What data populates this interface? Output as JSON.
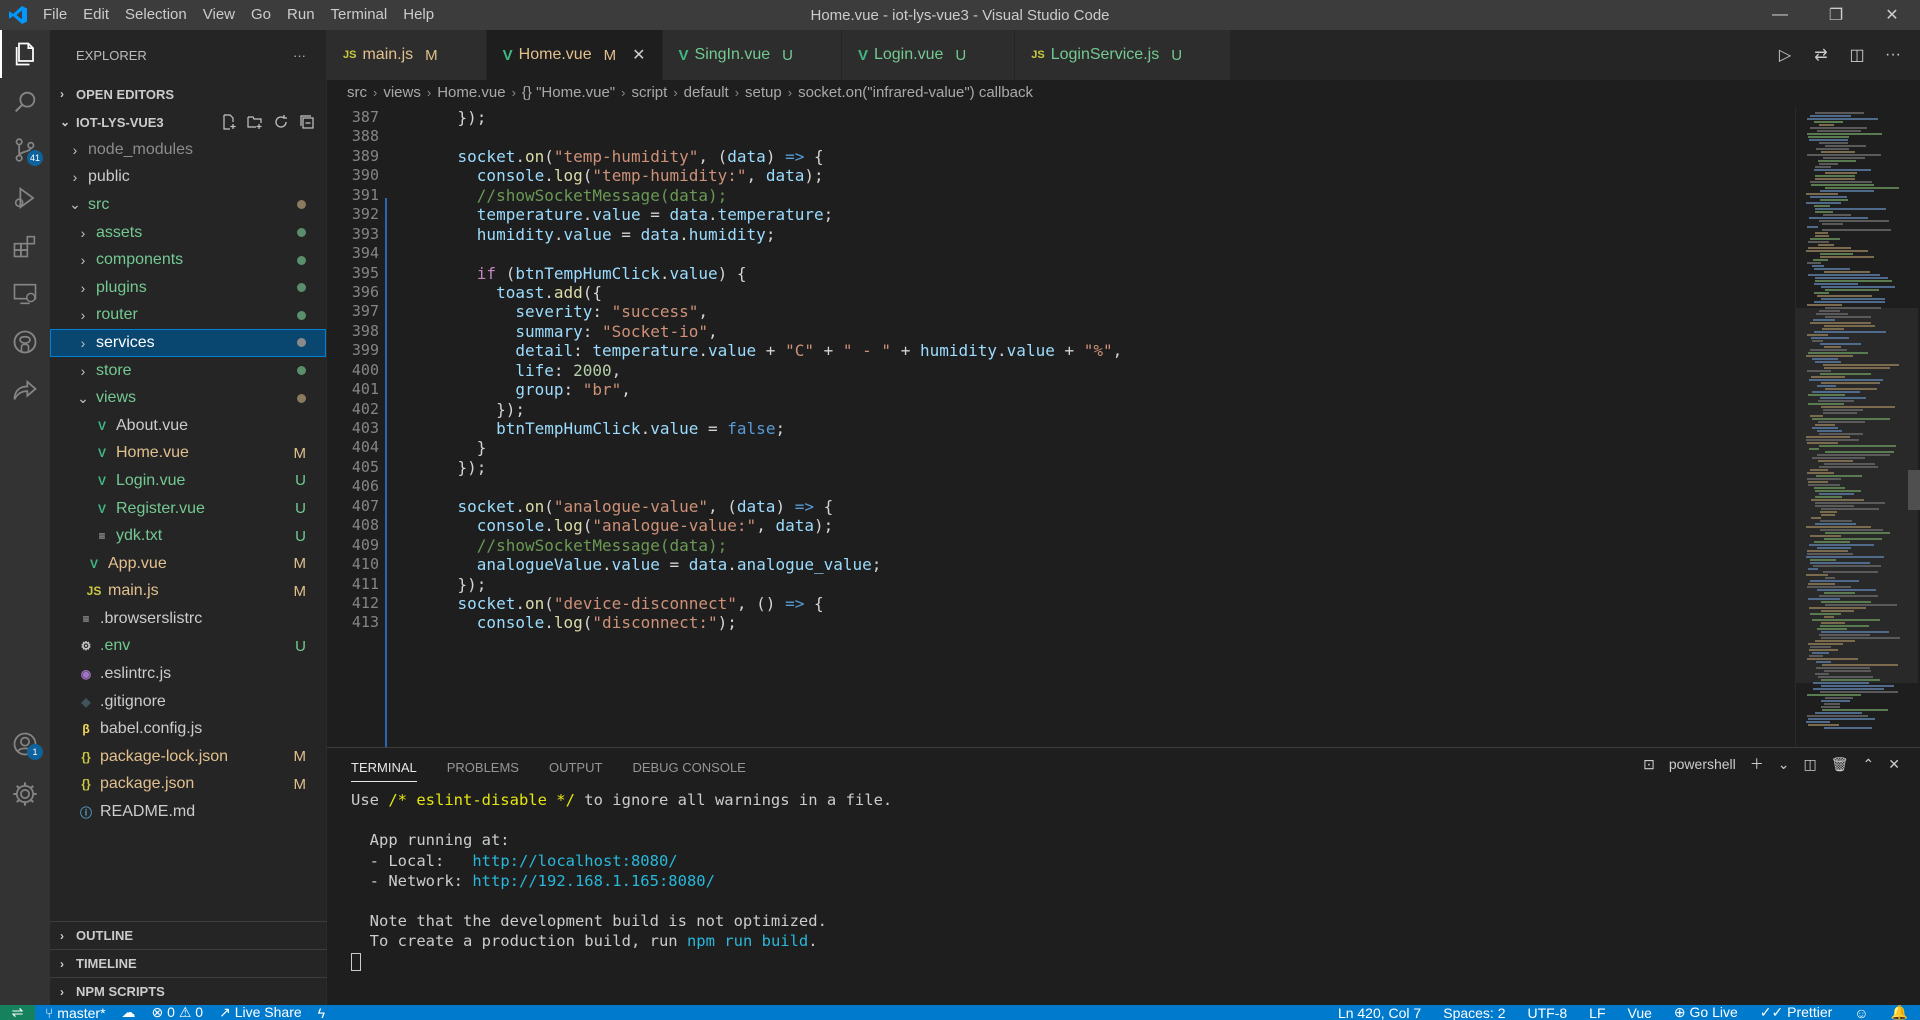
{
  "window": {
    "title": "Home.vue - iot-lys-vue3 - Visual Studio Code",
    "menu": [
      "File",
      "Edit",
      "Selection",
      "View",
      "Go",
      "Run",
      "Terminal",
      "Help"
    ],
    "controls": [
      "—",
      "❐",
      "✕"
    ]
  },
  "activity_bar": {
    "scm_badge": "41",
    "accounts_badge": "1",
    "items": [
      "explorer-icon",
      "search-icon",
      "source-control-icon",
      "run-debug-icon",
      "extensions-icon",
      "remote-explorer-icon",
      "github-icon",
      "live-share-icon",
      "accounts-icon",
      "settings-gear-icon"
    ]
  },
  "sidebar": {
    "header": "EXPLORER",
    "open_editors": "OPEN EDITORS",
    "project": "IOT-LYS-VUE3",
    "tree": [
      {
        "label": "node_modules",
        "type": "folder",
        "indent": 1,
        "color": "dim",
        "status": ""
      },
      {
        "label": "public",
        "type": "folder",
        "indent": 1,
        "color": "normal",
        "status": ""
      },
      {
        "label": "src",
        "type": "folder-open",
        "indent": 1,
        "color": "green",
        "status": "dot"
      },
      {
        "label": "assets",
        "type": "folder",
        "indent": 2,
        "color": "green",
        "status": "dot"
      },
      {
        "label": "components",
        "type": "folder",
        "indent": 2,
        "color": "green",
        "status": "dot"
      },
      {
        "label": "plugins",
        "type": "folder",
        "indent": 2,
        "color": "green",
        "status": "dot"
      },
      {
        "label": "router",
        "type": "folder",
        "indent": 2,
        "color": "green",
        "status": "dot"
      },
      {
        "label": "services",
        "type": "folder",
        "indent": 2,
        "color": "selected",
        "status": "dot"
      },
      {
        "label": "store",
        "type": "folder",
        "indent": 2,
        "color": "green",
        "status": "dot"
      },
      {
        "label": "views",
        "type": "folder-open",
        "indent": 2,
        "color": "green",
        "status": "dot"
      },
      {
        "label": "About.vue",
        "type": "vue",
        "indent": 3,
        "color": "normal",
        "status": ""
      },
      {
        "label": "Home.vue",
        "type": "vue",
        "indent": 3,
        "color": "mod",
        "status": "M"
      },
      {
        "label": "Login.vue",
        "type": "vue",
        "indent": 3,
        "color": "green",
        "status": "U"
      },
      {
        "label": "Register.vue",
        "type": "vue",
        "indent": 3,
        "color": "green",
        "status": "U"
      },
      {
        "label": "ydk.txt",
        "type": "txt",
        "indent": 3,
        "color": "green",
        "status": "U"
      },
      {
        "label": "App.vue",
        "type": "vue",
        "indent": 2,
        "color": "mod",
        "status": "M"
      },
      {
        "label": "main.js",
        "type": "js",
        "indent": 2,
        "color": "mod",
        "status": "M"
      },
      {
        "label": ".browserslistrc",
        "type": "list",
        "indent": 1,
        "color": "normal",
        "status": ""
      },
      {
        "label": ".env",
        "type": "gear",
        "indent": 1,
        "color": "green",
        "status": "U"
      },
      {
        "label": ".eslintrc.js",
        "type": "eslint",
        "indent": 1,
        "color": "normal",
        "status": ""
      },
      {
        "label": ".gitignore",
        "type": "git",
        "indent": 1,
        "color": "normal",
        "status": ""
      },
      {
        "label": "babel.config.js",
        "type": "babel",
        "indent": 1,
        "color": "normal",
        "status": ""
      },
      {
        "label": "package-lock.json",
        "type": "json",
        "indent": 1,
        "color": "mod",
        "status": "M"
      },
      {
        "label": "package.json",
        "type": "json",
        "indent": 1,
        "color": "mod",
        "status": "M"
      },
      {
        "label": "README.md",
        "type": "info",
        "indent": 1,
        "color": "normal",
        "status": ""
      }
    ],
    "bottom_sections": [
      "OUTLINE",
      "TIMELINE",
      "NPM SCRIPTS"
    ]
  },
  "tabs": [
    {
      "icon": "JS",
      "label": "main.js",
      "badge": "M",
      "active": false,
      "color": "mod"
    },
    {
      "icon": "V",
      "label": "Home.vue",
      "badge": "M",
      "active": true,
      "color": "mod"
    },
    {
      "icon": "V",
      "label": "SingIn.vue",
      "badge": "U",
      "active": false,
      "color": "green"
    },
    {
      "icon": "V",
      "label": "Login.vue",
      "badge": "U",
      "active": false,
      "color": "green"
    },
    {
      "icon": "JS",
      "label": "LoginService.js",
      "badge": "U",
      "active": false,
      "color": "green"
    }
  ],
  "breadcrumb": [
    "src",
    "views",
    "Home.vue",
    "{} \"Home.vue\"",
    "script",
    "default",
    "setup",
    "socket.on(\"infrared-value\") callback"
  ],
  "code": [
    {
      "n": "387",
      "t": [
        [
          "p",
          "    });"
        ]
      ]
    },
    {
      "n": "388",
      "t": []
    },
    {
      "n": "389",
      "t": [
        [
          "p",
          "    "
        ],
        [
          "v",
          "socket"
        ],
        [
          "p",
          "."
        ],
        [
          "f",
          "on"
        ],
        [
          "p",
          "("
        ],
        [
          "s",
          "\"temp-humidity\""
        ],
        [
          "p",
          ", ("
        ],
        [
          "v",
          "data"
        ],
        [
          "p",
          ") "
        ],
        [
          "b",
          "=>"
        ],
        [
          "p",
          " {"
        ]
      ]
    },
    {
      "n": "390",
      "t": [
        [
          "p",
          "      "
        ],
        [
          "v",
          "console"
        ],
        [
          "p",
          "."
        ],
        [
          "f",
          "log"
        ],
        [
          "p",
          "("
        ],
        [
          "s",
          "\"temp-humidity:\""
        ],
        [
          "p",
          ", "
        ],
        [
          "v",
          "data"
        ],
        [
          "p",
          ");"
        ]
      ]
    },
    {
      "n": "391",
      "t": [
        [
          "p",
          "      "
        ],
        [
          "c",
          "//showSocketMessage(data);"
        ]
      ]
    },
    {
      "n": "392",
      "t": [
        [
          "p",
          "      "
        ],
        [
          "v",
          "temperature"
        ],
        [
          "p",
          "."
        ],
        [
          "v",
          "value"
        ],
        [
          "p",
          " = "
        ],
        [
          "v",
          "data"
        ],
        [
          "p",
          "."
        ],
        [
          "v",
          "temperature"
        ],
        [
          "p",
          ";"
        ]
      ]
    },
    {
      "n": "393",
      "t": [
        [
          "p",
          "      "
        ],
        [
          "v",
          "humidity"
        ],
        [
          "p",
          "."
        ],
        [
          "v",
          "value"
        ],
        [
          "p",
          " = "
        ],
        [
          "v",
          "data"
        ],
        [
          "p",
          "."
        ],
        [
          "v",
          "humidity"
        ],
        [
          "p",
          ";"
        ]
      ]
    },
    {
      "n": "394",
      "t": []
    },
    {
      "n": "395",
      "t": [
        [
          "p",
          "      "
        ],
        [
          "k",
          "if"
        ],
        [
          "p",
          " ("
        ],
        [
          "v",
          "btnTempHumClick"
        ],
        [
          "p",
          "."
        ],
        [
          "v",
          "value"
        ],
        [
          "p",
          ") {"
        ]
      ]
    },
    {
      "n": "396",
      "t": [
        [
          "p",
          "        "
        ],
        [
          "v",
          "toast"
        ],
        [
          "p",
          "."
        ],
        [
          "f",
          "add"
        ],
        [
          "p",
          "({"
        ]
      ]
    },
    {
      "n": "397",
      "t": [
        [
          "p",
          "          "
        ],
        [
          "v",
          "severity"
        ],
        [
          "p",
          ": "
        ],
        [
          "s",
          "\"success\""
        ],
        [
          "p",
          ","
        ]
      ]
    },
    {
      "n": "398",
      "t": [
        [
          "p",
          "          "
        ],
        [
          "v",
          "summary"
        ],
        [
          "p",
          ": "
        ],
        [
          "s",
          "\"Socket-io\""
        ],
        [
          "p",
          ","
        ]
      ]
    },
    {
      "n": "399",
      "t": [
        [
          "p",
          "          "
        ],
        [
          "v",
          "detail"
        ],
        [
          "p",
          ": "
        ],
        [
          "v",
          "temperature"
        ],
        [
          "p",
          "."
        ],
        [
          "v",
          "value"
        ],
        [
          "p",
          " + "
        ],
        [
          "s",
          "\"C\""
        ],
        [
          "p",
          " + "
        ],
        [
          "s",
          "\" - \""
        ],
        [
          "p",
          " + "
        ],
        [
          "v",
          "humidity"
        ],
        [
          "p",
          "."
        ],
        [
          "v",
          "value"
        ],
        [
          "p",
          " + "
        ],
        [
          "s",
          "\"%\""
        ],
        [
          "p",
          ","
        ]
      ]
    },
    {
      "n": "400",
      "t": [
        [
          "p",
          "          "
        ],
        [
          "v",
          "life"
        ],
        [
          "p",
          ": "
        ],
        [
          "n",
          "2000"
        ],
        [
          "p",
          ","
        ]
      ]
    },
    {
      "n": "401",
      "t": [
        [
          "p",
          "          "
        ],
        [
          "v",
          "group"
        ],
        [
          "p",
          ": "
        ],
        [
          "s",
          "\"br\""
        ],
        [
          "p",
          ","
        ]
      ]
    },
    {
      "n": "402",
      "t": [
        [
          "p",
          "        });"
        ]
      ]
    },
    {
      "n": "403",
      "t": [
        [
          "p",
          "        "
        ],
        [
          "v",
          "btnTempHumClick"
        ],
        [
          "p",
          "."
        ],
        [
          "v",
          "value"
        ],
        [
          "p",
          " = "
        ],
        [
          "b",
          "false"
        ],
        [
          "p",
          ";"
        ]
      ]
    },
    {
      "n": "404",
      "t": [
        [
          "p",
          "      }"
        ]
      ]
    },
    {
      "n": "405",
      "t": [
        [
          "p",
          "    });"
        ]
      ]
    },
    {
      "n": "406",
      "t": []
    },
    {
      "n": "407",
      "t": [
        [
          "p",
          "    "
        ],
        [
          "v",
          "socket"
        ],
        [
          "p",
          "."
        ],
        [
          "f",
          "on"
        ],
        [
          "p",
          "("
        ],
        [
          "s",
          "\"analogue-value\""
        ],
        [
          "p",
          ", ("
        ],
        [
          "v",
          "data"
        ],
        [
          "p",
          ") "
        ],
        [
          "b",
          "=>"
        ],
        [
          "p",
          " {"
        ]
      ]
    },
    {
      "n": "408",
      "t": [
        [
          "p",
          "      "
        ],
        [
          "v",
          "console"
        ],
        [
          "p",
          "."
        ],
        [
          "f",
          "log"
        ],
        [
          "p",
          "("
        ],
        [
          "s",
          "\"analogue-value:\""
        ],
        [
          "p",
          ", "
        ],
        [
          "v",
          "data"
        ],
        [
          "p",
          ");"
        ]
      ]
    },
    {
      "n": "409",
      "t": [
        [
          "p",
          "      "
        ],
        [
          "c",
          "//showSocketMessage(data);"
        ]
      ]
    },
    {
      "n": "410",
      "t": [
        [
          "p",
          "      "
        ],
        [
          "v",
          "analogueValue"
        ],
        [
          "p",
          "."
        ],
        [
          "v",
          "value"
        ],
        [
          "p",
          " = "
        ],
        [
          "v",
          "data"
        ],
        [
          "p",
          "."
        ],
        [
          "v",
          "analogue_value"
        ],
        [
          "p",
          ";"
        ]
      ]
    },
    {
      "n": "411",
      "t": [
        [
          "p",
          "    });"
        ]
      ]
    },
    {
      "n": "412",
      "t": [
        [
          "p",
          "    "
        ],
        [
          "v",
          "socket"
        ],
        [
          "p",
          "."
        ],
        [
          "f",
          "on"
        ],
        [
          "p",
          "("
        ],
        [
          "s",
          "\"device-disconnect\""
        ],
        [
          "p",
          ", () "
        ],
        [
          "b",
          "=>"
        ],
        [
          "p",
          " {"
        ]
      ]
    },
    {
      "n": "413",
      "t": [
        [
          "p",
          "      "
        ],
        [
          "v",
          "console"
        ],
        [
          "p",
          "."
        ],
        [
          "f",
          "log"
        ],
        [
          "p",
          "("
        ],
        [
          "s",
          "\"disconnect:\""
        ],
        [
          "p",
          ");"
        ]
      ]
    }
  ],
  "panel": {
    "tabs": [
      "TERMINAL",
      "PROBLEMS",
      "OUTPUT",
      "DEBUG CONSOLE"
    ],
    "shell": "powershell",
    "terminal": [
      [
        [
          "",
          "Use "
        ],
        [
          "t-yellow",
          "/* eslint-disable */"
        ],
        [
          "",
          " to ignore all warnings in a file."
        ]
      ],
      [],
      [
        [
          "",
          "  App running at:"
        ]
      ],
      [
        [
          "",
          "  - Local:   "
        ],
        [
          "t-cyan",
          "http://localhost:8080/"
        ]
      ],
      [
        [
          "",
          "  - Network: "
        ],
        [
          "t-cyan",
          "http://192.168.1.165:8080/"
        ]
      ],
      [],
      [
        [
          "",
          "  Note that the development build is not optimized."
        ]
      ],
      [
        [
          "",
          "  To create a production build, run "
        ],
        [
          "t-cyan",
          "npm run build"
        ],
        [
          "",
          "."
        ]
      ],
      []
    ]
  },
  "statusbar": {
    "branch": "master*",
    "errors": "0",
    "warnings": "0",
    "live_share": "Live Share",
    "position": "Ln 420, Col 7",
    "spaces": "Spaces: 2",
    "encoding": "UTF-8",
    "eol": "LF",
    "language": "Vue",
    "go_live": "Go Live",
    "prettier": "Prettier"
  },
  "colors": {
    "accent": "#007acc",
    "selection": "#094771",
    "modified": "#e2c08d",
    "untracked": "#73c991",
    "vue_icon": "#41b883",
    "js_icon": "#cbcb41"
  }
}
